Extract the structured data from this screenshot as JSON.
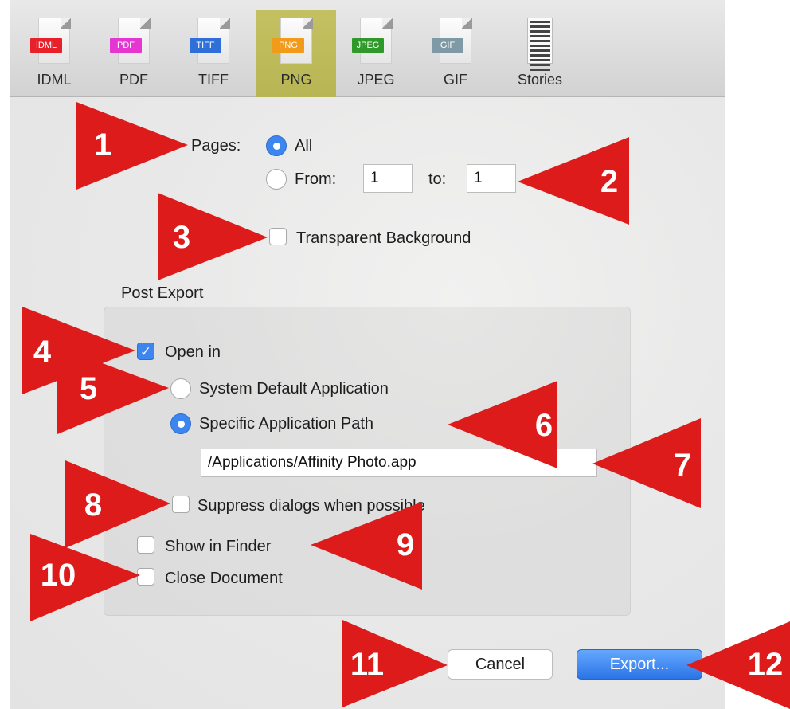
{
  "toolbar": {
    "items": [
      {
        "label": "IDML",
        "badge": "IDML",
        "badge_color": "#e8202a"
      },
      {
        "label": "PDF",
        "badge": "PDF",
        "badge_color": "#e636d2"
      },
      {
        "label": "TIFF",
        "badge": "TIFF",
        "badge_color": "#2f6fd8"
      },
      {
        "label": "PNG",
        "badge": "PNG",
        "badge_color": "#f29a1a"
      },
      {
        "label": "JPEG",
        "badge": "JPEG",
        "badge_color": "#2f9a2a"
      },
      {
        "label": "GIF",
        "badge": "GIF",
        "badge_color": "#7f9aa6"
      },
      {
        "label": "Stories",
        "badge": "",
        "badge_color": ""
      }
    ],
    "selected": "PNG"
  },
  "pages": {
    "label": "Pages:",
    "all_label": "All",
    "all_selected": true,
    "from_label": "From:",
    "from_value": "1",
    "to_label": "to:",
    "to_value": "1"
  },
  "transparent_background": {
    "label": "Transparent Background",
    "checked": false
  },
  "post_export": {
    "title": "Post Export",
    "open_in": {
      "label": "Open in",
      "checked": true
    },
    "system_default": {
      "label": "System Default Application",
      "selected": false
    },
    "specific_path": {
      "label": "Specific Application Path",
      "selected": true,
      "value": "/Applications/Affinity Photo.app"
    },
    "suppress_dialogs": {
      "label": "Suppress dialogs when possible",
      "checked": false
    },
    "show_in_finder": {
      "label": "Show in Finder",
      "checked": false
    },
    "close_document": {
      "label": "Close Document",
      "checked": false
    }
  },
  "buttons": {
    "cancel": "Cancel",
    "export": "Export..."
  },
  "callouts": [
    "1",
    "2",
    "3",
    "4",
    "5",
    "6",
    "7",
    "8",
    "9",
    "10",
    "11",
    "12"
  ],
  "colors": {
    "callout": "#dd1b1b",
    "accent": "#3d86f0",
    "selected_tab": "#bdb95a"
  }
}
